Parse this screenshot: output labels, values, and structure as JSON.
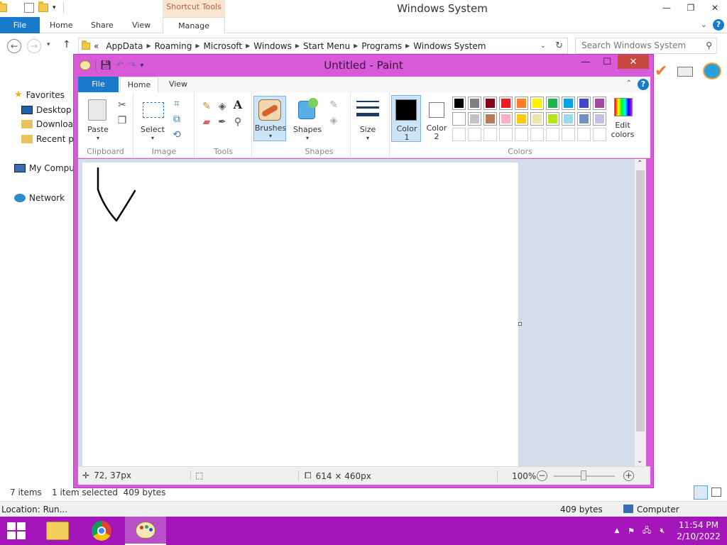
{
  "explorer": {
    "title": "Windows System",
    "contextual_tab": "Shortcut Tools",
    "tabs": [
      "File",
      "Home",
      "Share",
      "View",
      "Manage"
    ],
    "address": {
      "prefix": "«",
      "crumbs": [
        "AppData",
        "Roaming",
        "Microsoft",
        "Windows",
        "Start Menu",
        "Programs",
        "Windows System"
      ]
    },
    "search_placeholder": "Search Windows System",
    "sidebar": {
      "favorites": "Favorites",
      "desktop": "Desktop",
      "downloads": "Downloac",
      "recent": "Recent pla",
      "computer": "My Compu",
      "network": "Network"
    },
    "status": {
      "items": "7 items",
      "selected": "1 item selected  409 bytes"
    },
    "location": {
      "text": "Location: Run...",
      "size": "409 bytes",
      "zone": "Computer"
    }
  },
  "paint": {
    "title": "Untitled - Paint",
    "tabs": {
      "file": "File",
      "home": "Home",
      "view": "View"
    },
    "groups": {
      "clipboard": "Clipboard",
      "image": "Image",
      "tools": "Tools",
      "shapes": "Shapes",
      "colors": "Colors"
    },
    "buttons": {
      "paste": "Paste",
      "select": "Select",
      "brushes": "Brushes",
      "shapes": "Shapes",
      "size": "Size",
      "color1_a": "Color",
      "color1_b": "1",
      "color2_a": "Color",
      "color2_b": "2",
      "edit_a": "Edit",
      "edit_b": "colors"
    },
    "palette_row1": [
      "#000000",
      "#7f7f7f",
      "#880015",
      "#ed1c24",
      "#ff7f27",
      "#fff200",
      "#22b14c",
      "#00a2e8",
      "#3f48cc",
      "#a349a4"
    ],
    "palette_row2": [
      "#ffffff",
      "#c3c3c3",
      "#b97a57",
      "#ffaec9",
      "#ffc90e",
      "#efe4b0",
      "#b5e61d",
      "#99d9ea",
      "#7092be",
      "#c8bfe7"
    ],
    "color1": "#000000",
    "color2": "#ffffff",
    "status": {
      "cursor": "72, 37px",
      "canvas_size": "614 × 460px",
      "zoom": "100%"
    }
  },
  "taskbar": {
    "time": "11:54 PM",
    "date": "2/10/2022"
  }
}
